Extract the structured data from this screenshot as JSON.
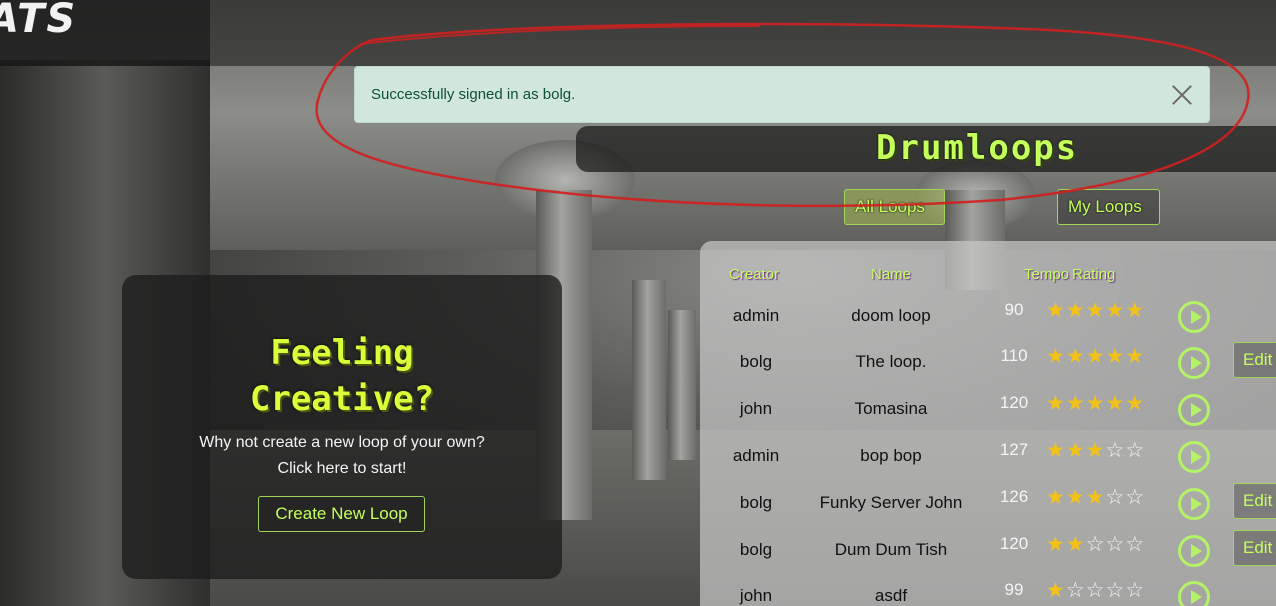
{
  "header": {
    "logo_text": "ATS"
  },
  "flash": {
    "message": "Successfully signed in as bolg.",
    "close_icon": "close-icon"
  },
  "drumloops": {
    "title": "Drumloops",
    "tabs": [
      {
        "label": "All Loops",
        "active": true
      },
      {
        "label": "My Loops",
        "active": false
      }
    ]
  },
  "promo": {
    "title_line1": "Feeling",
    "title_line2": "Creative?",
    "text_line1": "Why not create a new loop of your own?",
    "text_line2": "Click here to start!",
    "button_label": "Create New Loop"
  },
  "table": {
    "headers": {
      "creator": "Creator",
      "name": "Name",
      "tempo": "Tempo",
      "rating": "Rating"
    },
    "edit_label": "Edit",
    "rows": [
      {
        "creator": "admin",
        "name": "doom loop",
        "tempo": "90",
        "rating": 5,
        "editable": false
      },
      {
        "creator": "bolg",
        "name": "The loop.",
        "tempo": "110",
        "rating": 5,
        "editable": true
      },
      {
        "creator": "john",
        "name": "Tomasina",
        "tempo": "120",
        "rating": 5,
        "editable": false
      },
      {
        "creator": "admin",
        "name": "bop bop",
        "tempo": "127",
        "rating": 3,
        "editable": false
      },
      {
        "creator": "bolg",
        "name": "Funky Server John",
        "tempo": "126",
        "rating": 3,
        "editable": true
      },
      {
        "creator": "bolg",
        "name": "Dum Dum Tish",
        "tempo": "120",
        "rating": 2,
        "editable": true
      },
      {
        "creator": "john",
        "name": "asdf",
        "tempo": "99",
        "rating": 1,
        "editable": false
      }
    ]
  },
  "colors": {
    "accent": "#c4ff5c",
    "star": "#f2c21b",
    "flash_bg": "#d1e7dd",
    "annotation": "#d21f1f"
  }
}
